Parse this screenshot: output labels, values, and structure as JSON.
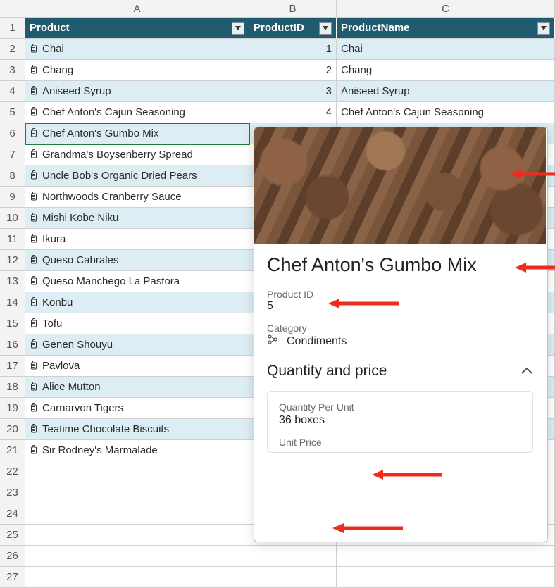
{
  "columns": {
    "A": "A",
    "B": "B",
    "C": "C"
  },
  "headers": {
    "product": "Product",
    "productId": "ProductID",
    "productName": "ProductName"
  },
  "rows": [
    {
      "product": "Chai",
      "id": "1",
      "name": "Chai"
    },
    {
      "product": "Chang",
      "id": "2",
      "name": "Chang"
    },
    {
      "product": "Aniseed Syrup",
      "id": "3",
      "name": "Aniseed Syrup"
    },
    {
      "product": "Chef Anton's Cajun Seasoning",
      "id": "4",
      "name": "Chef Anton's Cajun Seasoning"
    },
    {
      "product": "Chef Anton's Gumbo Mix",
      "id": "",
      "name": ""
    },
    {
      "product": "Grandma's Boysenberry Spread",
      "id": "",
      "name": ""
    },
    {
      "product": "Uncle Bob's Organic Dried Pears",
      "id": "",
      "name": ""
    },
    {
      "product": "Northwoods Cranberry Sauce",
      "id": "",
      "name": ""
    },
    {
      "product": "Mishi Kobe Niku",
      "id": "",
      "name": ""
    },
    {
      "product": "Ikura",
      "id": "",
      "name": ""
    },
    {
      "product": "Queso Cabrales",
      "id": "",
      "name": ""
    },
    {
      "product": "Queso Manchego La Pastora",
      "id": "",
      "name": ""
    },
    {
      "product": "Konbu",
      "id": "",
      "name": ""
    },
    {
      "product": "Tofu",
      "id": "",
      "name": ""
    },
    {
      "product": "Genen Shouyu",
      "id": "",
      "name": ""
    },
    {
      "product": "Pavlova",
      "id": "",
      "name": ""
    },
    {
      "product": "Alice Mutton",
      "id": "",
      "name": ""
    },
    {
      "product": "Carnarvon Tigers",
      "id": "",
      "name": ""
    },
    {
      "product": "Teatime Chocolate Biscuits",
      "id": "",
      "name": ""
    },
    {
      "product": "Sir Rodney's Marmalade",
      "id": "",
      "name": ""
    }
  ],
  "blankRows": [
    "22",
    "23",
    "24",
    "25",
    "26",
    "27"
  ],
  "selectedRowIndex": 4,
  "card": {
    "title": "Chef Anton's Gumbo Mix",
    "productId_label": "Product ID",
    "productId_value": "5",
    "category_label": "Category",
    "category_value": "Condiments",
    "section_title": "Quantity and price",
    "qpu_label": "Quantity Per Unit",
    "qpu_value": "36 boxes",
    "unitprice_label": "Unit Price"
  }
}
